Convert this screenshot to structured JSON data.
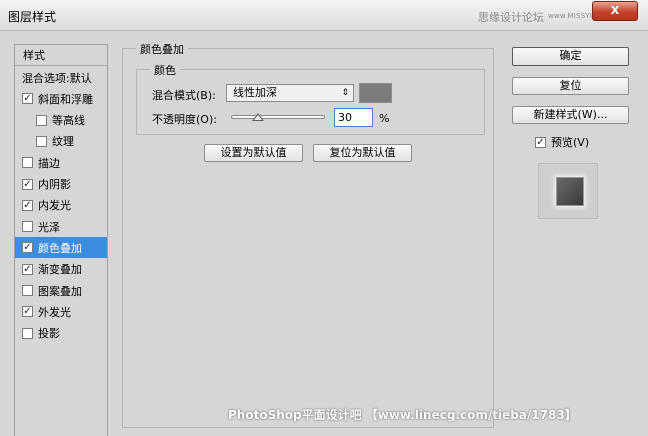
{
  "window": {
    "title": "图层样式",
    "site_watermark": "思缘设计论坛",
    "site_url": "www.MISSYUAN.COM",
    "close_glyph": "X"
  },
  "styles_panel": {
    "header": "样式",
    "items": [
      {
        "label": "混合选项:默认",
        "has_checkbox": false,
        "checked": false,
        "selected": false,
        "sub": false
      },
      {
        "label": "斜面和浮雕",
        "has_checkbox": true,
        "checked": true,
        "selected": false,
        "sub": false
      },
      {
        "label": "等高线",
        "has_checkbox": true,
        "checked": false,
        "selected": false,
        "sub": true
      },
      {
        "label": "纹理",
        "has_checkbox": true,
        "checked": false,
        "selected": false,
        "sub": true
      },
      {
        "label": "描边",
        "has_checkbox": true,
        "checked": false,
        "selected": false,
        "sub": false
      },
      {
        "label": "内阴影",
        "has_checkbox": true,
        "checked": true,
        "selected": false,
        "sub": false
      },
      {
        "label": "内发光",
        "has_checkbox": true,
        "checked": true,
        "selected": false,
        "sub": false
      },
      {
        "label": "光泽",
        "has_checkbox": true,
        "checked": false,
        "selected": false,
        "sub": false
      },
      {
        "label": "颜色叠加",
        "has_checkbox": true,
        "checked": true,
        "selected": true,
        "sub": false
      },
      {
        "label": "渐变叠加",
        "has_checkbox": true,
        "checked": true,
        "selected": false,
        "sub": false
      },
      {
        "label": "图案叠加",
        "has_checkbox": true,
        "checked": false,
        "selected": false,
        "sub": false
      },
      {
        "label": "外发光",
        "has_checkbox": true,
        "checked": true,
        "selected": false,
        "sub": false
      },
      {
        "label": "投影",
        "has_checkbox": true,
        "checked": false,
        "selected": false,
        "sub": false
      }
    ]
  },
  "color_overlay": {
    "group_title": "颜色叠加",
    "color_group_title": "颜色",
    "blend_mode_label": "混合模式(B):",
    "blend_mode_value": "线性加深",
    "overlay_color": "#7c7c7c",
    "opacity_label": "不透明度(O):",
    "opacity_value": "30",
    "opacity_unit": "%",
    "opacity_level": 0.3,
    "set_default_button": "设置为默认值",
    "reset_default_button": "复位为默认值"
  },
  "actions": {
    "ok": "确定",
    "reset": "复位",
    "new_style": "新建样式(W)...",
    "preview_label": "预览(V)",
    "preview_checked": true
  },
  "footer_watermark": "PhotoShop平面设计吧 【www.linecg.com/tieba/1783】",
  "colors": {
    "selected_row": "#3c8ce0",
    "dialog_bg": "#d6d6d6",
    "close_button": "#c7432b"
  }
}
